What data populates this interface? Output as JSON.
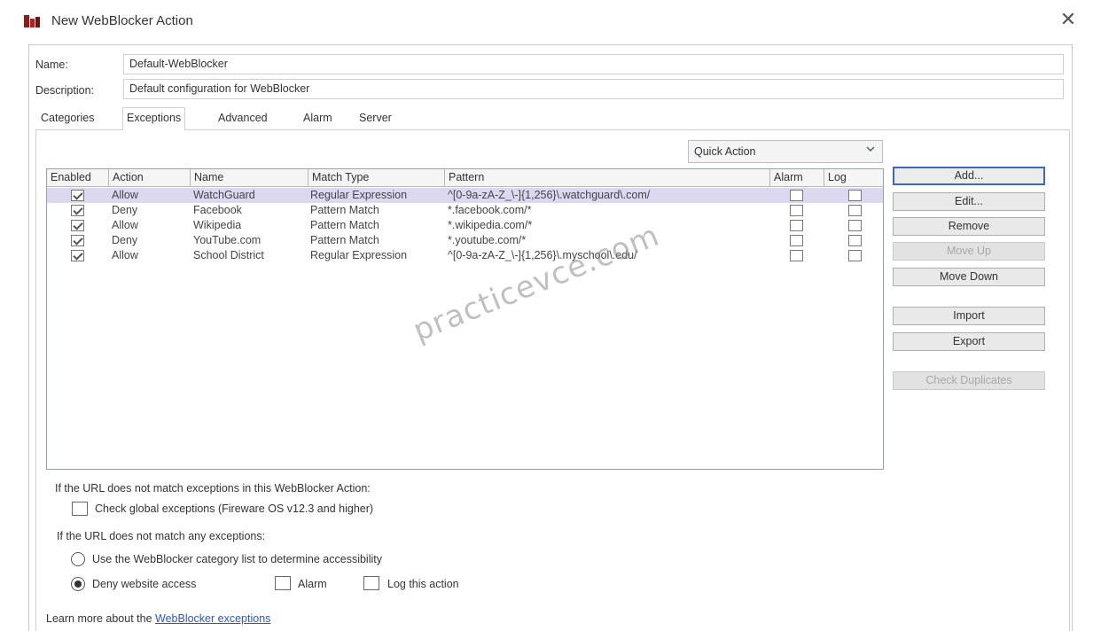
{
  "window": {
    "title": "New WebBlocker Action",
    "close_glyph": "✕"
  },
  "form": {
    "name_label": "Name:",
    "name_value": "Default-WebBlocker",
    "description_label": "Description:",
    "description_value": "Default configuration for WebBlocker"
  },
  "tabs": [
    {
      "label": "Categories"
    },
    {
      "label": "Exceptions",
      "active": true
    },
    {
      "label": "Advanced"
    },
    {
      "label": "Alarm"
    },
    {
      "label": "Server"
    }
  ],
  "quick_action": {
    "label": "Quick Action"
  },
  "table": {
    "headers": [
      "Enabled",
      "Action",
      "Name",
      "Match Type",
      "Pattern",
      "Alarm",
      "Log"
    ],
    "rows": [
      {
        "enabled": true,
        "action": "Allow",
        "name": "WatchGuard",
        "match_type": "Regular Expression",
        "pattern": "^[0-9a-zA-Z_\\-]{1,256}\\.watchguard\\.com/",
        "alarm": false,
        "log": false,
        "selected": true
      },
      {
        "enabled": true,
        "action": "Deny",
        "name": "Facebook",
        "match_type": "Pattern Match",
        "pattern": "*.facebook.com/*",
        "alarm": false,
        "log": false
      },
      {
        "enabled": true,
        "action": "Allow",
        "name": "Wikipedia",
        "match_type": "Pattern Match",
        "pattern": "*.wikipedia.com/*",
        "alarm": false,
        "log": false
      },
      {
        "enabled": true,
        "action": "Deny",
        "name": "YouTube.com",
        "match_type": "Pattern Match",
        "pattern": "*.youtube.com/*",
        "alarm": false,
        "log": false
      },
      {
        "enabled": true,
        "action": "Allow",
        "name": "School District",
        "match_type": "Regular Expression",
        "pattern": "^[0-9a-zA-Z_\\-]{1,256}\\.myschool\\.edu/",
        "alarm": false,
        "log": false
      }
    ]
  },
  "buttons": {
    "add": "Add...",
    "edit": "Edit...",
    "remove": "Remove",
    "move_up": "Move Up",
    "move_down": "Move Down",
    "import": "Import",
    "export": "Export",
    "check_duplicates": "Check Duplicates"
  },
  "watermark": "practicevce.com",
  "bottom": {
    "no_match_action_text": "If the URL does not match exceptions in this WebBlocker Action:",
    "check_global_label": "Check global exceptions (Fireware OS v12.3 and higher)",
    "no_match_any_text": "If the URL does not match any exceptions:",
    "use_category_label": "Use the WebBlocker category list to determine accessibility",
    "deny_label": "Deny website access",
    "alarm_label": "Alarm",
    "log_label": "Log this action",
    "learn_more_prefix": "Learn more about the",
    "learn_more_link": "WebBlocker exceptions"
  }
}
